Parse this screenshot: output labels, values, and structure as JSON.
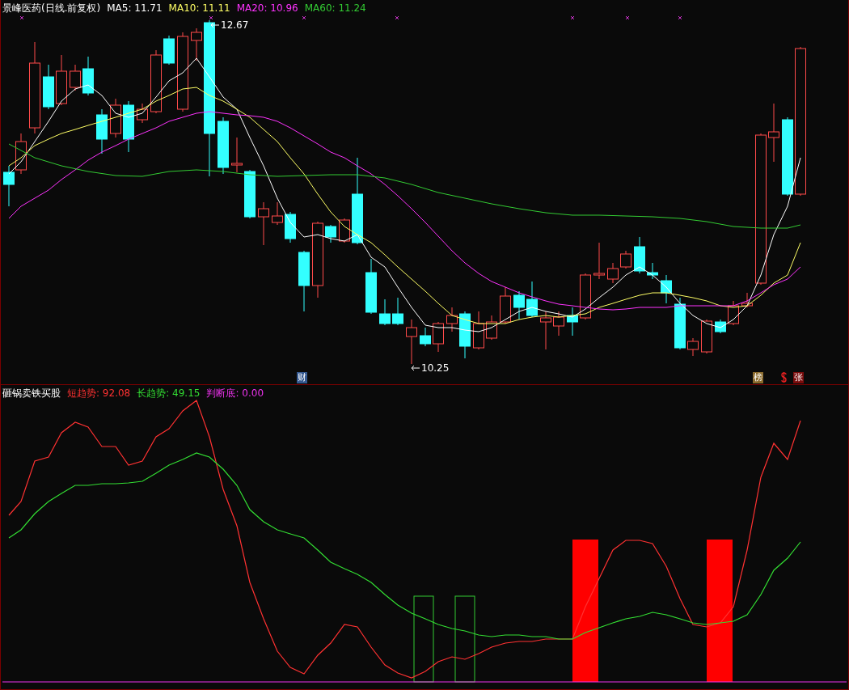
{
  "price_pane": {
    "title": "景峰医药(日线.前复权)",
    "moving_averages": [
      {
        "text": "MA5: 11.71",
        "color": "#ffffff"
      },
      {
        "text": "MA10: 11.11",
        "color": "#ffff66"
      },
      {
        "text": "MA20: 10.96",
        "color": "#ff33ff"
      },
      {
        "text": "MA60: 11.24",
        "color": "#33cc33"
      }
    ],
    "high_label": "12.67",
    "low_label": "10.25",
    "event_tags": [
      {
        "text": "财",
        "color": "#34588f"
      },
      {
        "text": "榜",
        "color": "#8a6a2c"
      },
      {
        "text": "张",
        "color": "#7a0c0c"
      }
    ]
  },
  "indicator_pane": {
    "title": "砸锅卖铁买股",
    "lines": [
      {
        "text": "短趋势: 92.08",
        "color": "#ff3232"
      },
      {
        "text": "长趋势: 49.15",
        "color": "#33dd33"
      },
      {
        "text": "判断底: 0.00",
        "color": "#ee33ee"
      }
    ]
  }
}
